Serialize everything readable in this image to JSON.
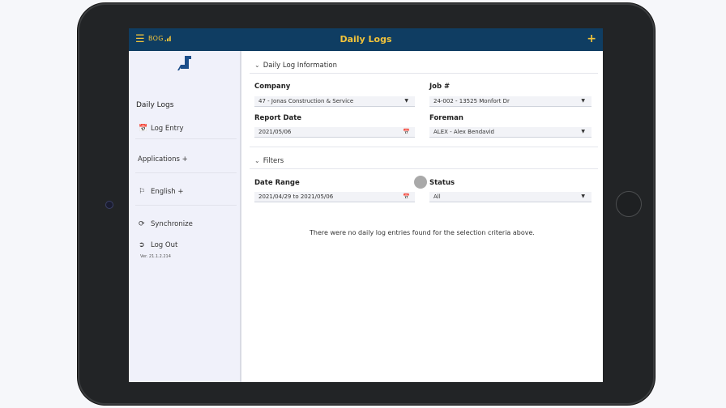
{
  "header": {
    "brand": "BOG",
    "title": "Daily Logs",
    "add_label": "+"
  },
  "sidebar": {
    "title": "Daily Logs",
    "items": [
      {
        "label": "Log Entry",
        "icon": "calendar-icon"
      },
      {
        "label": "Applications +",
        "icon": ""
      },
      {
        "label": "English +",
        "icon": "language-icon"
      },
      {
        "label": "Synchronize",
        "icon": "sync-icon"
      },
      {
        "label": "Log Out",
        "icon": "logout-icon"
      }
    ],
    "version": "Ver. 21.1.2.214"
  },
  "daily_log_info": {
    "heading": "Daily Log Information",
    "company_label": "Company",
    "company_value": "47 - Jonas Construction & Service",
    "job_label": "Job #",
    "job_value": "24-002 - 13525 Monfort Dr",
    "report_date_label": "Report Date",
    "report_date_value": "2021/05/06",
    "foreman_label": "Foreman",
    "foreman_value": "ALEX - Alex Bendavid"
  },
  "filters": {
    "heading": "Filters",
    "date_range_label": "Date Range",
    "date_range_value": "2021/04/29 to 2021/05/06",
    "status_label": "Status",
    "status_value": "All"
  },
  "empty_message": "There were no daily log entries found for the selection criteria above.",
  "colors": {
    "header_bg": "#0f3d62",
    "header_accent": "#f3c43a",
    "sidebar_bg": "#f0f1fa"
  }
}
